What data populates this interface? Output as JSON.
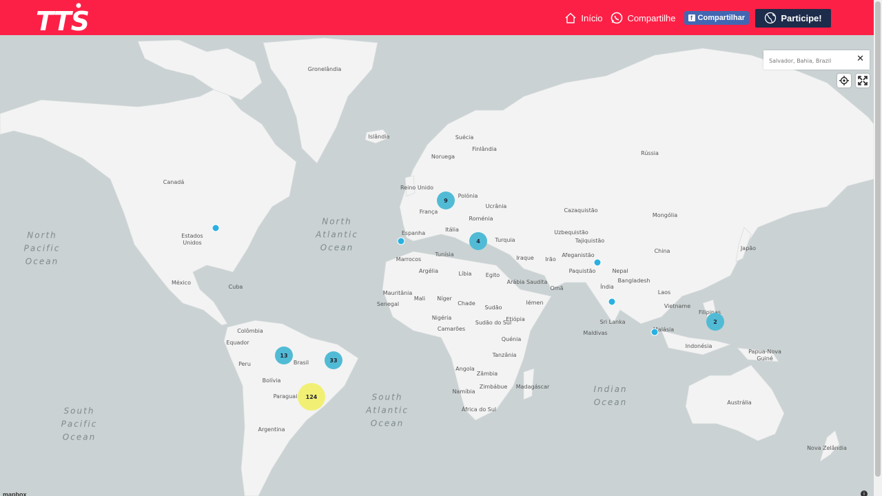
{
  "brand": {
    "logo_text": "TTS"
  },
  "nav": {
    "home_label": "Início",
    "share_label": "Compartilhe",
    "facebook_label": "Compartilhar",
    "participate_label": "Participe!"
  },
  "colors": {
    "header": "#fd2046",
    "cta": "#1d2c4b",
    "cluster_small": "#51bbd6",
    "cluster_large": "#f1f075",
    "point": "#2ab0e0"
  },
  "search": {
    "value": "Salvador, Bahia, Brazil"
  },
  "controls": {
    "locate_icon": "crosshair-icon",
    "fullscreen_icon": "fullscreen-icon"
  },
  "attribution": {
    "logo": "mapbox"
  },
  "map": {
    "oceans": [
      {
        "text": "North\nPacific\nOcean"
      },
      {
        "text": "North\nAtlantic\nOcean"
      },
      {
        "text": "South\nPacific\nOcean"
      },
      {
        "text": "South\nAtlantic\nOcean"
      },
      {
        "text": "Indian\nOcean"
      }
    ],
    "labels": [
      "Gronelândia",
      "Islândia",
      "Suécia",
      "Finlândia",
      "Noruega",
      "Reino Unido",
      "Polónia",
      "Ucrânia",
      "França",
      "Roménia",
      "Itália",
      "Espanha",
      "Turquia",
      "Tunísia",
      "Marrocos",
      "Argélia",
      "Líbia",
      "Egito",
      "Mauritânia",
      "Mali",
      "Níger",
      "Chade",
      "Sudão",
      "Senegal",
      "Nigéria",
      "Camarões",
      "Sudão do Sul",
      "Etiópia",
      "Quénia",
      "Tanzânia",
      "Angola",
      "Zâmbia",
      "Zimbábue",
      "Namíbia",
      "África do Sul",
      "Madagáscar",
      "Rússia",
      "Cazaquistão",
      "Mongólia",
      "Uzbequistão",
      "Tajiquistão",
      "Afeganistão",
      "Paquistão",
      "Iraque",
      "Irão",
      "Arábia Saudita",
      "Iémen",
      "Omã",
      "Índia",
      "Nepal",
      "Bangladesh",
      "China",
      "Japão",
      "Laos",
      "Vietname",
      "Filipinas",
      "Malásia",
      "Sri Lanka",
      "Maldivas",
      "Indonésia",
      "Papua-Nova Guiné",
      "Austrália",
      "Nova Zelândia",
      "Canadá",
      "Estados Unidos",
      "México",
      "Cuba",
      "Colômbia",
      "Equador",
      "Peru",
      "Brasil",
      "Bolívia",
      "Paraguai",
      "Argentina"
    ],
    "clusters": [
      {
        "count": "9",
        "kind": "small"
      },
      {
        "count": "4",
        "kind": "small"
      },
      {
        "count": "2",
        "kind": "small"
      },
      {
        "count": "13",
        "kind": "small"
      },
      {
        "count": "33",
        "kind": "small"
      },
      {
        "count": "124",
        "kind": "large"
      }
    ],
    "points": [
      "usa",
      "portugal",
      "india-north",
      "india-south",
      "malaysia"
    ]
  }
}
